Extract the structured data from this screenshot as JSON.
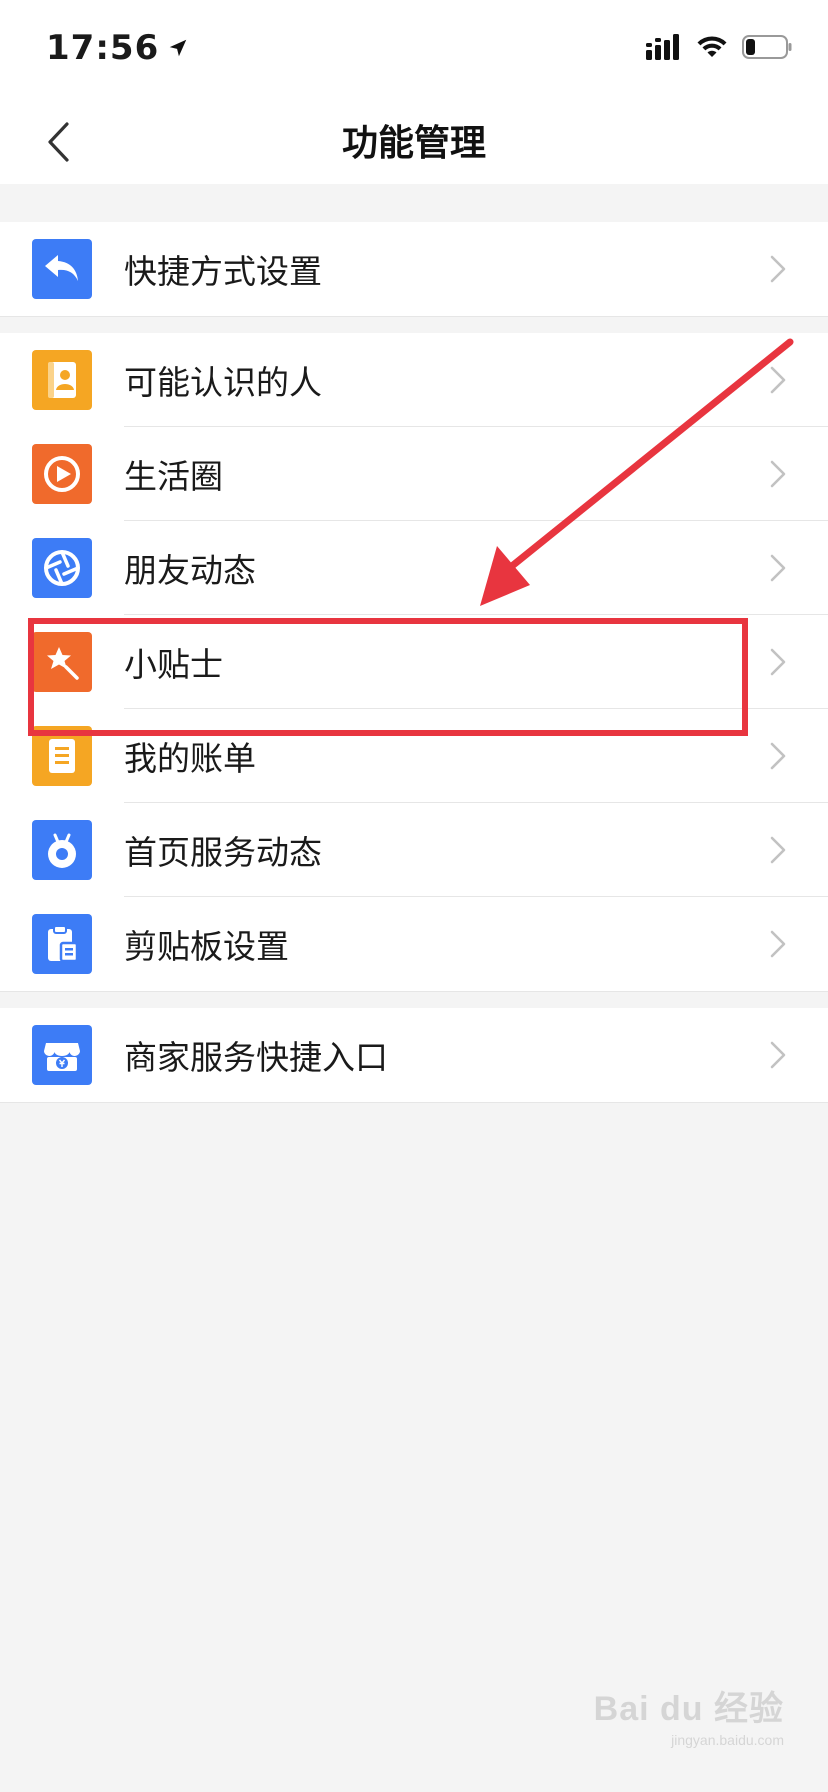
{
  "status_bar": {
    "time": "17:56"
  },
  "nav": {
    "title": "功能管理"
  },
  "groups": [
    {
      "items": [
        {
          "label": "快捷方式设置",
          "icon": "shortcut-reply-icon",
          "color": "#3d7cf6"
        }
      ]
    },
    {
      "items": [
        {
          "label": "可能认识的人",
          "icon": "contact-book-icon",
          "color": "#f5a623"
        },
        {
          "label": "生活圈",
          "icon": "play-circle-icon",
          "color": "#f06a2c"
        },
        {
          "label": "朋友动态",
          "icon": "shutter-icon",
          "color": "#3d7cf6"
        },
        {
          "label": "小贴士",
          "icon": "magic-wand-icon",
          "color": "#f06a2c"
        },
        {
          "label": "我的账单",
          "icon": "bill-list-icon",
          "color": "#f5a623"
        },
        {
          "label": "首页服务动态",
          "icon": "antenna-bot-icon",
          "color": "#3d7cf6"
        },
        {
          "label": "剪贴板设置",
          "icon": "clipboard-icon",
          "color": "#3d7cf6"
        }
      ]
    },
    {
      "items": [
        {
          "label": "商家服务快捷入口",
          "icon": "shop-yen-icon",
          "color": "#3d7cf6"
        }
      ]
    }
  ],
  "annotation": {
    "highlight_color": "#e8353f"
  },
  "watermark": {
    "logo": "Bai du 经验",
    "url": "jingyan.baidu.com"
  }
}
